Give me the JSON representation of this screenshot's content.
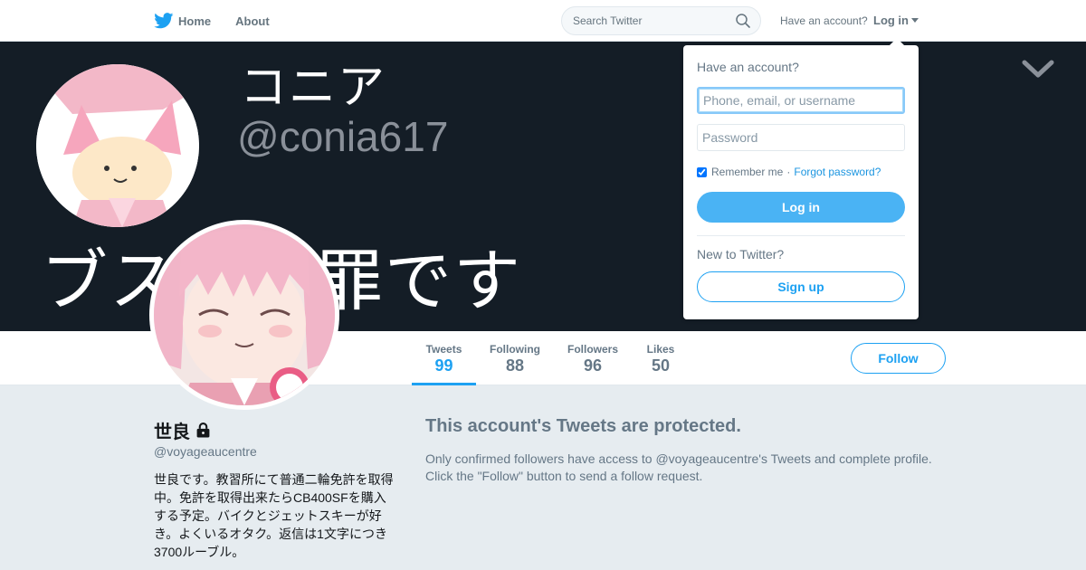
{
  "nav": {
    "home_label": "Home",
    "about_label": "About",
    "search_placeholder": "Search Twitter",
    "have_account": "Have an account?",
    "login_label": "Log in"
  },
  "banner": {
    "name": "コニア",
    "handle": "@conia617",
    "text": "ブスは犯罪です"
  },
  "profile_nav": {
    "stats": [
      {
        "label": "Tweets",
        "value": "99"
      },
      {
        "label": "Following",
        "value": "88"
      },
      {
        "label": "Followers",
        "value": "96"
      },
      {
        "label": "Likes",
        "value": "50"
      }
    ],
    "follow_label": "Follow"
  },
  "profile": {
    "name": "世良",
    "handle": "@voyageaucentre",
    "bio": "世良です。教習所にて普通二輪免許を取得中。免許を取得出来たらCB400SFを購入する予定。バイクとジェットスキーが好き。よくいるオタク。返信は1文字につき3700ルーブル。"
  },
  "protected": {
    "title": "This account's Tweets are protected.",
    "text": "Only confirmed followers have access to @voyageaucentre's Tweets and complete profile. Click the \"Follow\" button to send a follow request."
  },
  "login_dropdown": {
    "title": "Have an account?",
    "username_placeholder": "Phone, email, or username",
    "password_placeholder": "Password",
    "remember_label": "Remember me",
    "separator": "·",
    "forgot_label": "Forgot password?",
    "login_button": "Log in",
    "new_label": "New to Twitter?",
    "signup_button": "Sign up"
  },
  "colors": {
    "accent": "#1da1f2",
    "banner_bg": "#141d26",
    "page_bg": "#e6ecf0"
  },
  "icons": [
    "twitter-bird-icon",
    "search-icon",
    "caret-down-icon",
    "chevron-down-icon",
    "lock-icon"
  ]
}
